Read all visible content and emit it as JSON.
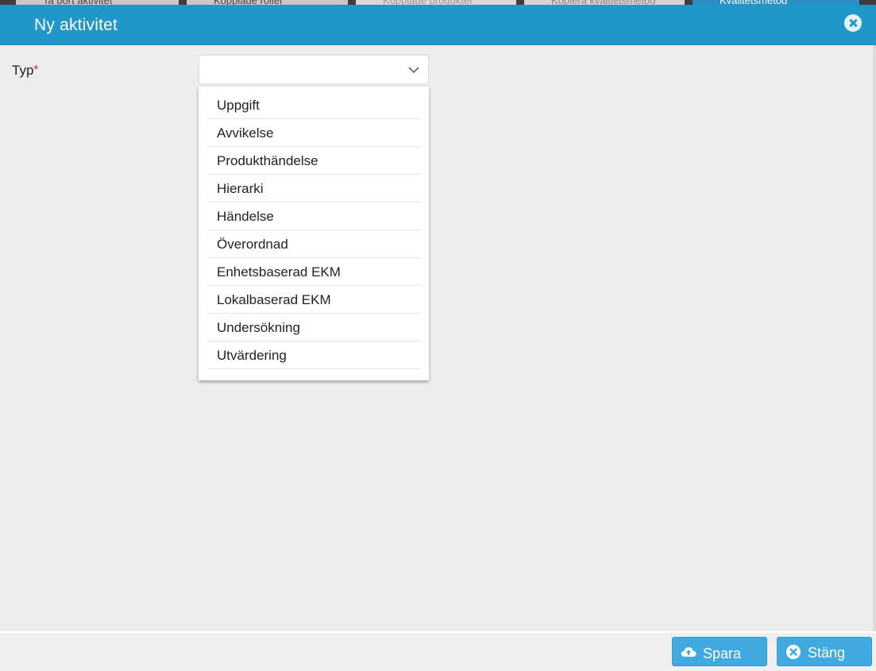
{
  "background_tabs": [
    {
      "label": "Ta bort aktivitet"
    },
    {
      "label": "Kopplade roller"
    },
    {
      "label": "Kopplade produkter"
    },
    {
      "label": "Kopiera kvalitetsmetod"
    },
    {
      "label": "Kvalitetsmetod"
    }
  ],
  "modal": {
    "title": "Ny aktivitet",
    "close_icon": "close-circle-icon"
  },
  "form": {
    "type_field": {
      "label": "Typ",
      "required_marker": "*",
      "selected_value": "",
      "options": [
        "Uppgift",
        "Avvikelse",
        "Produkthändelse",
        "Hierarki",
        "Händelse",
        "Överordnad",
        "Enhetsbaserad EKM",
        "Lokalbaserad EKM",
        "Undersökning",
        "Utvärdering"
      ]
    }
  },
  "footer": {
    "save_label": "Spara",
    "save_icon": "cloud-upload-icon",
    "close_label": "Stäng",
    "close_icon": "close-circle-icon"
  },
  "colors": {
    "header": "#2196c8",
    "button": "#40a9df",
    "required": "#d9292b"
  }
}
